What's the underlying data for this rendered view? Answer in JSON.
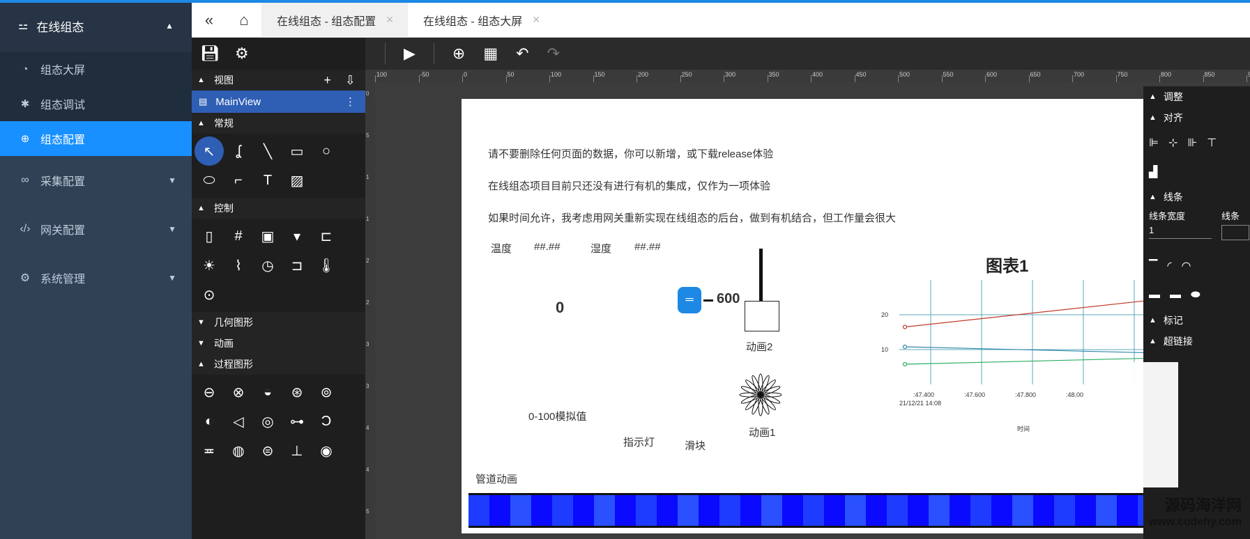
{
  "nav": {
    "header": "在线组态",
    "items": [
      {
        "label": "组态大屏",
        "icon": "dashboard-icon"
      },
      {
        "label": "组态调试",
        "icon": "bug-icon"
      },
      {
        "label": "组态配置",
        "icon": "crosshair-icon"
      }
    ],
    "groups": [
      {
        "label": "采集配置",
        "icon": "link-icon"
      },
      {
        "label": "网关配置",
        "icon": "code-icon"
      },
      {
        "label": "系统管理",
        "icon": "gear-icon"
      }
    ]
  },
  "tabs": [
    {
      "label": "在线组态 - 组态配置",
      "active": true
    },
    {
      "label": "在线组态 - 组态大屏",
      "active": false
    }
  ],
  "panel": {
    "view_section": "视图",
    "main_view": "MainView",
    "general_section": "常规",
    "control_section": "控制",
    "geometry_section": "几何图形",
    "animation_section": "动画",
    "process_section": "过程图形"
  },
  "page": {
    "line1": "请不要删除任何页面的数据，你可以新增，或下载release体验",
    "line2": "在线组态项目目前只还没有进行有机的集成，仅作为一项体验",
    "line3": "如果时间允许，我考虑用网关重新实现在线组态的后台，做到有机结合，但工作量会很大",
    "temp1_label": "温度",
    "temp1_value": "##.##",
    "temp2_label": "湿度",
    "temp2_value": "##.##",
    "zero_value": "0",
    "slider_value": "600",
    "anim2_label": "动画2",
    "anim1_label": "动画1",
    "analog_label": "0-100模拟值",
    "indicator_label": "指示灯",
    "slider_label": "滑块",
    "pipe_label": "管道动画"
  },
  "chart_data": {
    "type": "line",
    "title": "图表1",
    "xlabel": "时间",
    "ylabel": "",
    "y_ticks": [
      "20",
      "10"
    ],
    "x_ticks": [
      ":47.400",
      ":47.600",
      ":47.800",
      ":48.00"
    ],
    "x_start_label": "21/12/21 14:08",
    "series": [
      {
        "color": "#c0392b",
        "values": [
          16.5,
          24.5
        ]
      },
      {
        "color": "#2e86ab",
        "values": [
          10.8,
          9.0
        ]
      },
      {
        "color": "#27ae60",
        "values": [
          5.8,
          7.6
        ]
      }
    ]
  },
  "rpanel": {
    "adjust": "调整",
    "align": "对齐",
    "line": "线条",
    "line_width_label": "线条宽度",
    "line_width_value": "1",
    "line_type_label": "线条",
    "marker": "标记",
    "hyperlink": "超链接"
  },
  "watermark": {
    "title": "源码海洋网",
    "url": "www.codehy.com"
  }
}
